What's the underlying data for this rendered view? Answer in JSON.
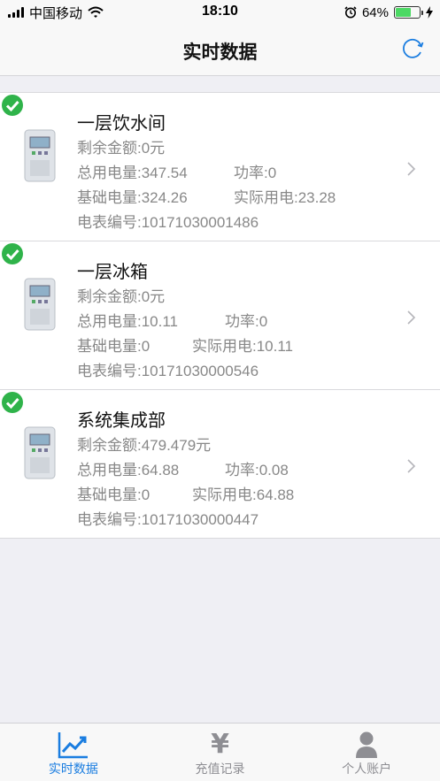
{
  "status_bar": {
    "carrier": "中国移动",
    "time": "18:10",
    "battery": "64%",
    "battery_level": 0.64,
    "icons": [
      "signal-icon",
      "wifi-icon",
      "alarm-icon",
      "battery-icon",
      "charging-icon"
    ]
  },
  "nav": {
    "title": "实时数据",
    "refresh_icon": "refresh-icon"
  },
  "meters": [
    {
      "name": "一层饮水间",
      "balance": "剩余金额:0元",
      "total": "总用电量:347.54",
      "power": "功率:0",
      "base": "基础电量:324.26",
      "actual": "实际用电:23.28",
      "meter_no": "电表编号:10171030001486"
    },
    {
      "name": "一层冰箱",
      "balance": "剩余金额:0元",
      "total": "总用电量:10.11",
      "power": "功率:0",
      "base": "基础电量:0",
      "actual": "实际用电:10.11",
      "meter_no": "电表编号:10171030000546"
    },
    {
      "name": "系统集成部",
      "balance": "剩余金额:479.479元",
      "total": "总用电量:64.88",
      "power": "功率:0.08",
      "base": "基础电量:0",
      "actual": "实际用电:64.88",
      "meter_no": "电表编号:10171030000447"
    }
  ],
  "tabs": [
    {
      "label": "实时数据",
      "icon": "chart-icon",
      "active": true
    },
    {
      "label": "充值记录",
      "icon": "yen-icon",
      "glyph": "¥",
      "active": false
    },
    {
      "label": "个人账户",
      "icon": "user-icon",
      "active": false
    }
  ],
  "colors": {
    "accent": "#1a7de0",
    "check": "#2fb34a",
    "muted_text": "#888888",
    "background": "#efeff4"
  }
}
